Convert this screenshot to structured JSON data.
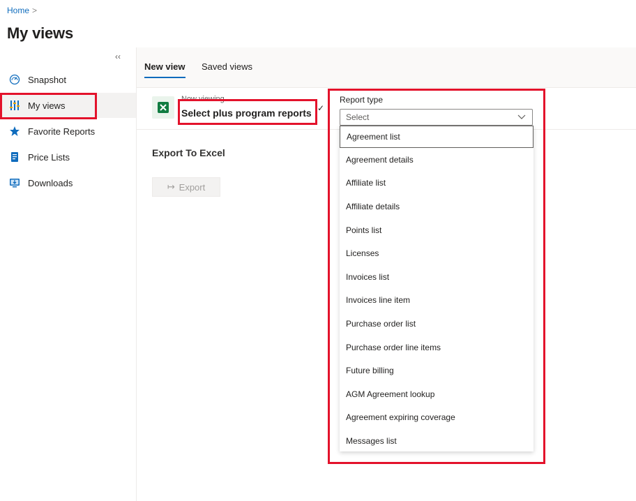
{
  "breadcrumb": {
    "home": "Home",
    "separator": ">"
  },
  "page": {
    "title": "My views"
  },
  "sidebar": {
    "collapse": "‹‹",
    "items": [
      {
        "label": "Snapshot",
        "icon": "gauge-icon"
      },
      {
        "label": "My views",
        "icon": "sliders-icon",
        "active": true
      },
      {
        "label": "Favorite Reports",
        "icon": "star-icon"
      },
      {
        "label": "Price Lists",
        "icon": "price-list-icon"
      },
      {
        "label": "Downloads",
        "icon": "download-icon"
      }
    ]
  },
  "tabs": [
    {
      "label": "New view",
      "active": true
    },
    {
      "label": "Saved views"
    }
  ],
  "viewing": {
    "caption": "Now viewing",
    "name": "Select plus program reports",
    "check": "✓"
  },
  "export": {
    "heading": "Export To Excel",
    "button": "Export",
    "arrow": "↦"
  },
  "report_type": {
    "label": "Report type",
    "placeholder": "Select",
    "options": [
      "Agreement list",
      "Agreement details",
      "Affiliate list",
      "Affiliate details",
      "Points list",
      "Licenses",
      "Invoices list",
      "Invoices line item",
      "Purchase order list",
      "Purchase order line items",
      "Future billing",
      "AGM Agreement lookup",
      "Agreement expiring coverage",
      "Messages list"
    ]
  },
  "colors": {
    "accent": "#0f6cbd",
    "highlight": "#e3122b",
    "excel": "#107c41"
  }
}
